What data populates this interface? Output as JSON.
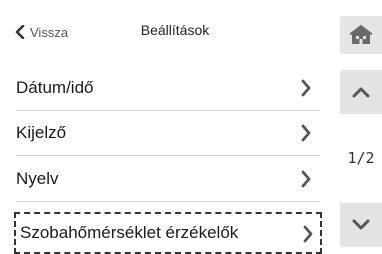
{
  "header": {
    "back_label": "Vissza",
    "title": "Beállítások",
    "back_icon": "chevron-left-icon",
    "home_icon": "home-icon"
  },
  "menu": {
    "items": [
      {
        "label": "Dátum/idő",
        "icon": "chevron-right-icon"
      },
      {
        "label": "Kijelző",
        "icon": "chevron-right-icon"
      },
      {
        "label": "Nyelv",
        "icon": "chevron-right-icon"
      },
      {
        "label": "Szobahőmérséklet érzékelők",
        "icon": "chevron-right-icon",
        "selected": true
      }
    ]
  },
  "pager": {
    "indicator": "1/2",
    "up_icon": "chevron-up-icon",
    "down_icon": "chevron-down-icon"
  },
  "colors": {
    "button_bg": "#e3e3e3",
    "icon": "#555555",
    "divider": "#cfcfcf"
  }
}
